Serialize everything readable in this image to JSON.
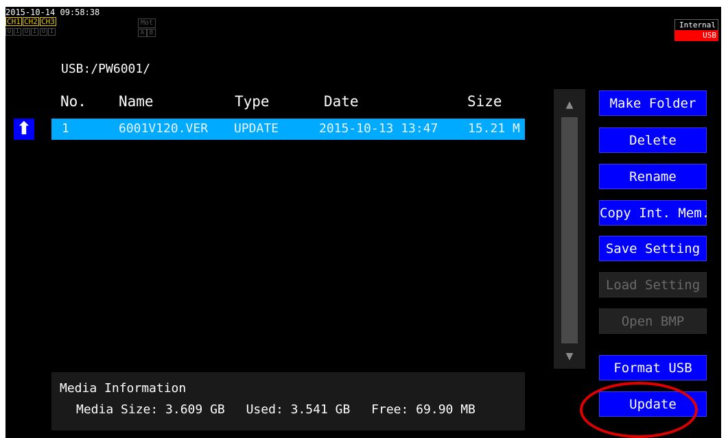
{
  "status": {
    "datetime": "2015-10-14 09:58:38",
    "channels": [
      "CH1",
      "CH2",
      "CH3"
    ],
    "ui_indicators": [
      "U",
      "I",
      "U",
      "I",
      "U",
      "I"
    ],
    "motor": {
      "label": "Mot",
      "a": "A",
      "b": "B"
    },
    "memory": {
      "internal": "Internal",
      "usb": "USB",
      "active_color": "#ff0000"
    }
  },
  "path": "USB:/PW6001/",
  "table": {
    "headers": [
      "No.",
      "Name",
      "Type",
      "Date",
      "Size"
    ],
    "rows": [
      {
        "no": "1",
        "name": "6001V120.VER",
        "type": "UPDATE",
        "date": "2015-10-13 13:47",
        "size": "15.21 M"
      }
    ],
    "selected_color": "#00aaff",
    "up_icon": "up-arrow-icon"
  },
  "buttons": {
    "make_folder": "Make Folder",
    "delete": "Delete",
    "rename": "Rename",
    "copy_int_mem": "Copy Int. Mem.",
    "save_setting": "Save Setting",
    "load_setting": "Load Setting",
    "open_bmp": "Open BMP",
    "format_usb": "Format USB",
    "update": "Update",
    "accent": "#0000ff"
  },
  "media": {
    "title": "Media Information",
    "size": "Media Size: 3.609 GB",
    "used": "Used: 3.541 GB",
    "free": "Free: 69.90 MB"
  },
  "scroll": {
    "up_icon": "▲",
    "down_icon": "▼"
  }
}
